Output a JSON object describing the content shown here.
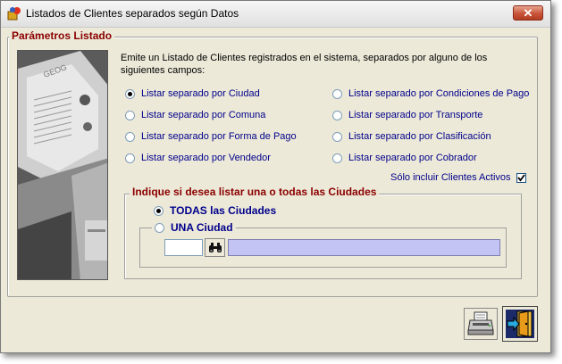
{
  "window": {
    "title": "Listados de Clientes separados según Datos",
    "close_symbol": "✕"
  },
  "params": {
    "legend": "Parámetros Listado",
    "description": "Emite un Listado de Clientes registrados en el sistema, separados por alguno de los siguientes campos:",
    "options": [
      {
        "label": "Listar separado por Ciudad",
        "checked": true
      },
      {
        "label": "Listar separado por Comuna",
        "checked": false
      },
      {
        "label": "Listar separado por Forma de Pago",
        "checked": false
      },
      {
        "label": "Listar separado por Vendedor",
        "checked": false
      },
      {
        "label": "Listar separado por Condiciones de Pago",
        "checked": false
      },
      {
        "label": "Listar separado por Transporte",
        "checked": false
      },
      {
        "label": "Listar separado por Clasificación",
        "checked": false
      },
      {
        "label": "Listar separado por Cobrador",
        "checked": false
      }
    ],
    "only_active_label": "Sólo incluir Clientes Activos",
    "only_active_checked": true
  },
  "cities": {
    "legend": "Indique si desea listar una o todas las Ciudades",
    "all_label": "TODAS las Ciudades",
    "all_checked": true,
    "one_label": "UNA Ciudad",
    "one_checked": false,
    "code_value": "",
    "name_value": ""
  },
  "colors": {
    "accent": "#8b0000",
    "label_blue": "#00008b",
    "city_name_bg": "#c4c4f4"
  },
  "icons": {
    "search": "binoculars-icon",
    "print": "printer-icon",
    "exit": "exit-door-icon"
  }
}
